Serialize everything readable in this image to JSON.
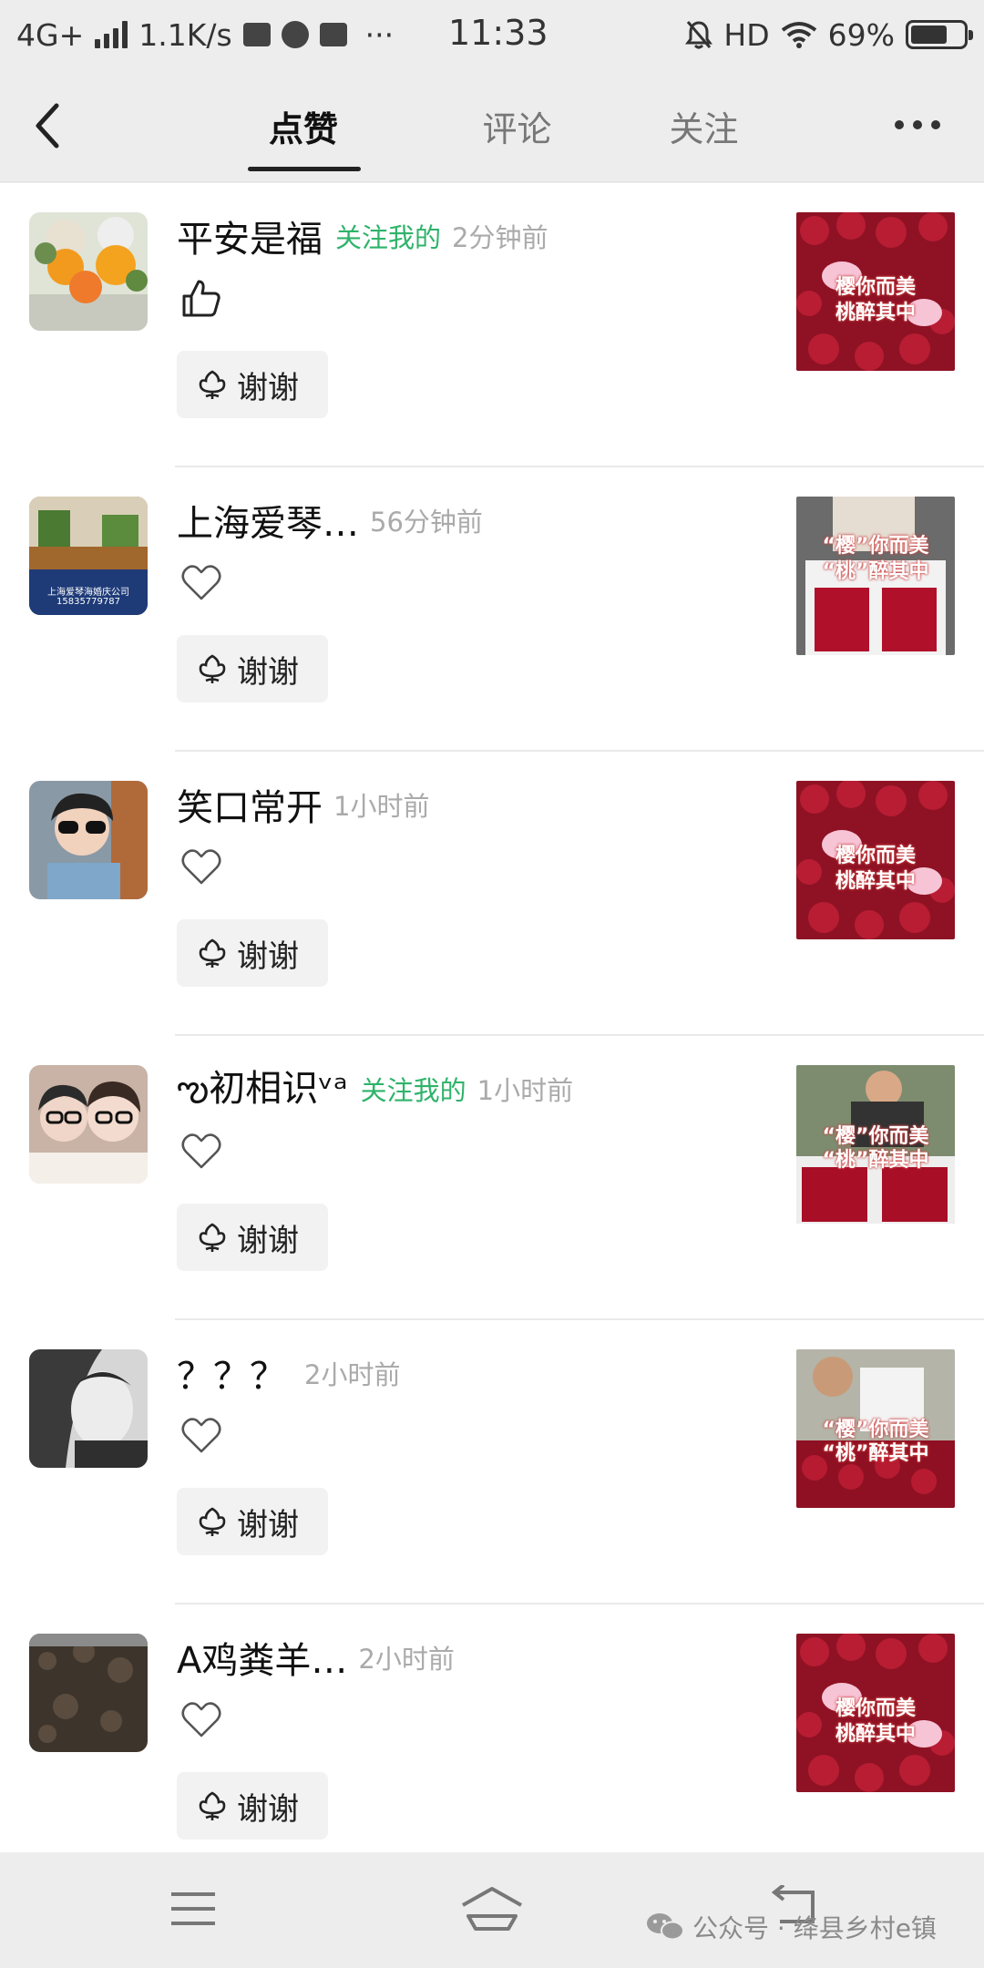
{
  "status_bar": {
    "network": "4G+",
    "speed": "1.1K/s",
    "extra": "···",
    "time": "11:33",
    "hd": "HD",
    "battery": "69%",
    "battery_level": 0.69
  },
  "header": {
    "tabs": [
      {
        "label": "点赞",
        "active": true
      },
      {
        "label": "评论",
        "active": false
      },
      {
        "label": "关注",
        "active": false
      }
    ]
  },
  "thanks_label": "谢谢",
  "items": [
    {
      "name": "平安是福",
      "follow": "关注我的",
      "time": "2分钟前",
      "like_icon": "thumbs-up-icon",
      "thumb_text": [
        "樱你而美",
        "桃醉其中"
      ]
    },
    {
      "name": "上海爱琴…",
      "follow": "",
      "time": "56分钟前",
      "like_icon": "heart-icon",
      "thumb_text": [
        "“樱”你而美",
        "“桃”醉其中"
      ]
    },
    {
      "name": "笑口常开",
      "follow": "",
      "time": "1小时前",
      "like_icon": "heart-icon",
      "thumb_text": [
        "樱你而美",
        "桃醉其中"
      ]
    },
    {
      "name": "ఌ初相识ᵛᵃ",
      "follow": "关注我的",
      "time": "1小时前",
      "like_icon": "heart-icon",
      "thumb_text": [
        "“樱”你而美",
        "“桃”醉其中"
      ]
    },
    {
      "name": "？？？",
      "follow": "",
      "time": "2小时前",
      "like_icon": "heart-icon",
      "thumb_text": [
        "“樱”你而美",
        "“桃”醉其中"
      ]
    },
    {
      "name": "A鸡粪羊…",
      "follow": "",
      "time": "2小时前",
      "like_icon": "heart-icon",
      "thumb_text": [
        "樱你而美",
        "桃醉其中"
      ]
    }
  ],
  "avatar_text": {
    "shop": "上海爱琴海婚庆公司",
    "phone": "15835779787"
  },
  "watermark": "公众号 · 绛县乡村e镇",
  "colors": {
    "follow_green": "#2fb36a",
    "cherry_red": "#9b1427"
  }
}
